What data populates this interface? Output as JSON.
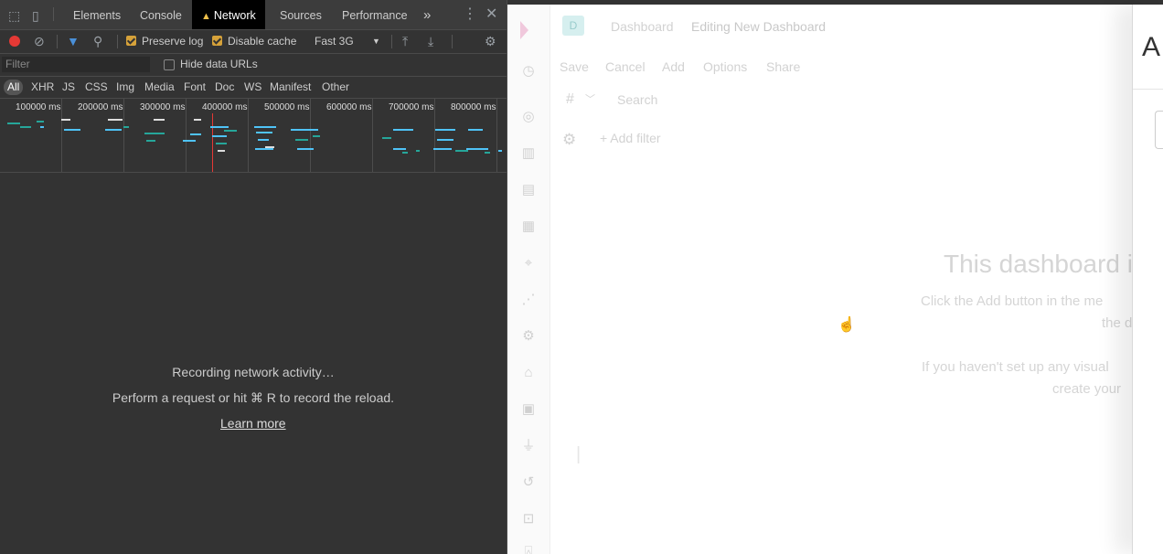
{
  "devtools": {
    "tabs": [
      "Elements",
      "Console",
      "Network",
      "Sources",
      "Performance"
    ],
    "active_tab": "Network",
    "more_tabs_glyph": "»",
    "toolbar": {
      "preserve_log_label": "Preserve log",
      "preserve_log_checked": true,
      "disable_cache_label": "Disable cache",
      "disable_cache_checked": true,
      "throttling_value": "Fast 3G"
    },
    "filter": {
      "placeholder": "Filter",
      "hide_data_urls_label": "Hide data URLs",
      "hide_data_urls_checked": false
    },
    "resource_types": [
      "All",
      "XHR",
      "JS",
      "CSS",
      "Img",
      "Media",
      "Font",
      "Doc",
      "WS",
      "Manifest",
      "Other"
    ],
    "active_type": "All",
    "overview_ticks": [
      "100000 ms",
      "200000 ms",
      "300000 ms",
      "400000 ms",
      "500000 ms",
      "600000 ms",
      "700000 ms",
      "800000 ms"
    ],
    "empty_state": {
      "recording": "Recording network activity…",
      "hint": "Perform a request or hit ⌘ R to record the reload.",
      "learn_more": "Learn more"
    },
    "colors": {
      "accent_record": "#e53935",
      "checkbox": "#d6a23a",
      "bar_blue": "#4fc3f7",
      "bar_green": "#26a69a"
    }
  },
  "kibana": {
    "avatar_letter": "D",
    "breadcrumbs": [
      "Dashboard",
      "Editing New Dashboard"
    ],
    "menu": [
      "Save",
      "Cancel",
      "Add",
      "Options",
      "Share"
    ],
    "query_language_glyph": "#",
    "search_placeholder": "Search",
    "add_filter": "+ Add filter",
    "empty_title": "This dashboard is",
    "empty_line1": "Click the Add button in the me",
    "empty_line2": "the d",
    "empty_line3": "If you haven't set up any visual",
    "empty_line4": "create your",
    "flyout_title_letter": "A"
  }
}
